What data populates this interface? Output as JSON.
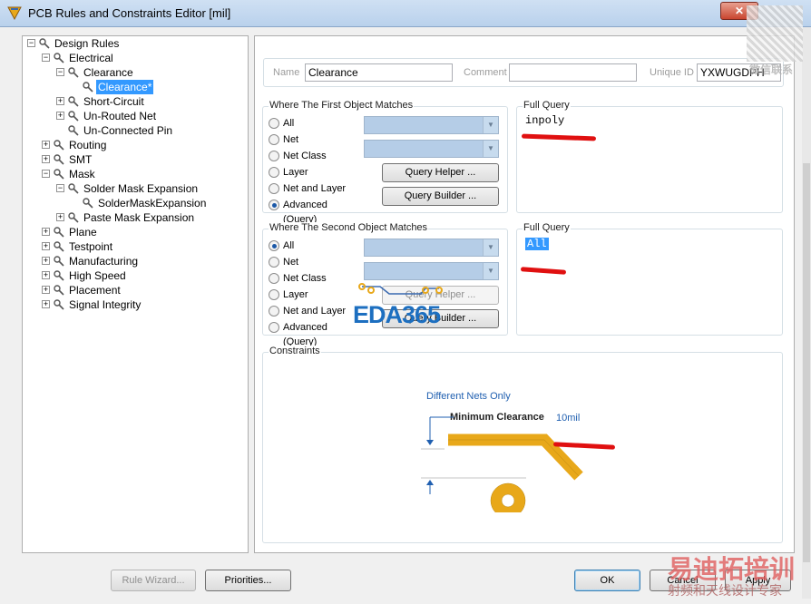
{
  "window": {
    "title": "PCB Rules and Constraints Editor [mil]",
    "close_glyph": "✕"
  },
  "tree": {
    "items": [
      {
        "label": "Design Rules",
        "depth": 0,
        "expander": "−"
      },
      {
        "label": "Electrical",
        "depth": 1,
        "expander": "−"
      },
      {
        "label": "Clearance",
        "depth": 2,
        "expander": "−"
      },
      {
        "label": "Clearance*",
        "depth": 3,
        "expander": "",
        "selected": true
      },
      {
        "label": "Short-Circuit",
        "depth": 2,
        "expander": "+"
      },
      {
        "label": "Un-Routed Net",
        "depth": 2,
        "expander": "+"
      },
      {
        "label": "Un-Connected Pin",
        "depth": 2,
        "expander": ""
      },
      {
        "label": "Routing",
        "depth": 1,
        "expander": "+"
      },
      {
        "label": "SMT",
        "depth": 1,
        "expander": "+"
      },
      {
        "label": "Mask",
        "depth": 1,
        "expander": "−"
      },
      {
        "label": "Solder Mask Expansion",
        "depth": 2,
        "expander": "−"
      },
      {
        "label": "SolderMaskExpansion",
        "depth": 3,
        "expander": ""
      },
      {
        "label": "Paste Mask Expansion",
        "depth": 2,
        "expander": "+"
      },
      {
        "label": "Plane",
        "depth": 1,
        "expander": "+"
      },
      {
        "label": "Testpoint",
        "depth": 1,
        "expander": "+"
      },
      {
        "label": "Manufacturing",
        "depth": 1,
        "expander": "+"
      },
      {
        "label": "High Speed",
        "depth": 1,
        "expander": "+"
      },
      {
        "label": "Placement",
        "depth": 1,
        "expander": "+"
      },
      {
        "label": "Signal Integrity",
        "depth": 1,
        "expander": "+"
      }
    ]
  },
  "rule": {
    "name_label": "Name",
    "name_value": "Clearance",
    "comment_label": "Comment",
    "comment_value": "",
    "uid_label": "Unique ID",
    "uid_value": "YXWUGDPH"
  },
  "first": {
    "title": "Where The First Object Matches",
    "options": [
      "All",
      "Net",
      "Net Class",
      "Layer",
      "Net and Layer",
      "Advanced (Query)"
    ],
    "selected": "Advanced (Query)",
    "helper": "Query Helper ...",
    "builder": "Query Builder ...",
    "full_query_title": "Full Query",
    "full_query": "inpoly"
  },
  "second": {
    "title": "Where The Second Object Matches",
    "options": [
      "All",
      "Net",
      "Net Class",
      "Layer",
      "Net and Layer",
      "Advanced (Query)"
    ],
    "selected": "All",
    "helper": "Query Helper ...",
    "builder": "Query Builder ...",
    "full_query_title": "Full Query",
    "full_query": "All"
  },
  "constraints": {
    "title": "Constraints",
    "nets_label": "Different Nets Only",
    "min_label": "Minimum Clearance",
    "min_value": "10mil"
  },
  "footer": {
    "rule_wizard": "Rule Wizard...",
    "priorities": "Priorities...",
    "ok": "OK",
    "cancel": "Cancel",
    "apply": "Apply"
  },
  "watermarks": {
    "eda": "EDA365",
    "cn_big": "易迪拓培训",
    "cn_small": "射频和天线设计专家",
    "side": "微信联系"
  },
  "colors": {
    "selection": "#3399ff",
    "trace": "#e8a81a",
    "annotation_blue": "#1f5fb0",
    "red_mark": "#e01010"
  }
}
